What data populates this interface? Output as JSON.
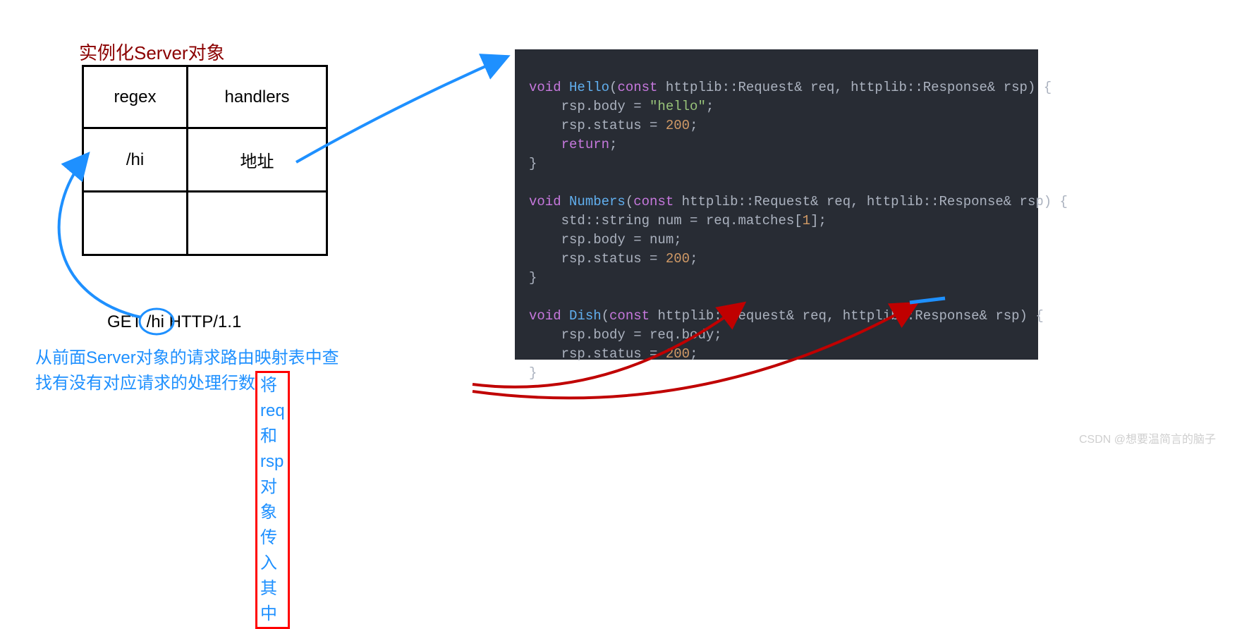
{
  "title": "实例化Server对象",
  "table": {
    "row1": {
      "col1": "regex",
      "col2": "handlers"
    },
    "row2": {
      "col1": "/hi",
      "col2": "地址"
    },
    "row3": {
      "col1": "",
      "col2": ""
    }
  },
  "http_line": {
    "prefix": "GET ",
    "path": "/hi",
    "suffix": " HTTP/1.1"
  },
  "explanation": {
    "line1": "从前面Server对象的请求路由映射表中查",
    "line2_part1": "找有没有对应请求的处理行数 ",
    "line2_boxed": "将req和rsp对象传入其中"
  },
  "code": {
    "l1_void": "void",
    "l1_fn": "Hello",
    "l1_rest": "(",
    "l1_const": "const",
    "l1_type1": " httplib::Request& req, httplib::Response& rsp) {",
    "l2": "    rsp.body = ",
    "l2_str": "\"hello\"",
    "l2_end": ";",
    "l3": "    rsp.status = ",
    "l3_num": "200",
    "l3_end": ";",
    "l4_kw": "    return",
    "l4_end": ";",
    "l5": "}",
    "l6": "",
    "l7_void": "void",
    "l7_fn": "Numbers",
    "l7_rest": "(",
    "l7_const": "const",
    "l7_type1": " httplib::Request& req, httplib::Response& rsp) {",
    "l8": "    std::string num = req.matches[",
    "l8_num": "1",
    "l8_end": "];",
    "l9": "    rsp.body = num;",
    "l10": "    rsp.status = ",
    "l10_num": "200",
    "l10_end": ";",
    "l11": "}",
    "l12": "",
    "l13_void": "void",
    "l13_fn": "Dish",
    "l13_rest": "(",
    "l13_const": "const",
    "l13_type1": " httplib::Request& req, httplib::Response& rsp) {",
    "l14": "    rsp.body = req.body;",
    "l15": "    rsp.status = ",
    "l15_num": "200",
    "l15_end": ";",
    "l16": "}"
  },
  "watermark": "CSDN @想要温简言的脑子"
}
